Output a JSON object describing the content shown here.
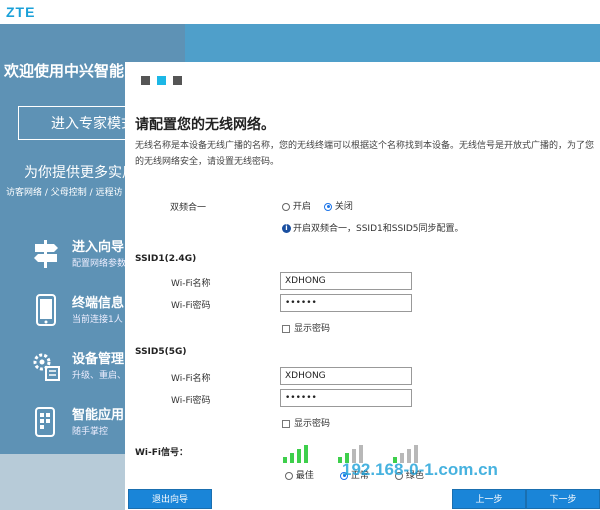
{
  "brand": {
    "logo": "ZTE"
  },
  "background": {
    "welcome": "欢迎使用中兴智能",
    "expert_button": "进入专家模式",
    "offer": "为你提供更多实用",
    "offer_sub": "访客网络 / 父母控制 / 远程访",
    "menu": [
      {
        "title": "进入向导",
        "sub": "配置网络参数",
        "icon": "signpost-icon"
      },
      {
        "title": "终端信息",
        "sub": "当前连接1人",
        "icon": "phone-icon"
      },
      {
        "title": "设备管理",
        "sub": "升级、重启、",
        "icon": "gears-icon"
      },
      {
        "title": "智能应用",
        "sub": "随手掌控",
        "icon": "apps-icon"
      }
    ]
  },
  "wizard": {
    "steps": [
      false,
      true,
      false
    ],
    "title": "请配置您的无线网络。",
    "description": "无线名称是本设备无线广播的名称，您的无线终端可以根据这个名称找到本设备。无线信号是开放式广播的，为了您的无线网络安全，请设置无线密码。",
    "dual_band": {
      "label": "双频合一",
      "options": [
        "开启",
        "关闭"
      ],
      "selected": "关闭",
      "hint": "开启双频合一，SSID1和SSID5同步配置。"
    },
    "ssid1": {
      "heading": "SSID1(2.4G)",
      "name_label": "Wi-Fi名称",
      "name_value": "XDHONG",
      "password_label": "Wi-Fi密码",
      "password_value": "••••••",
      "show_password": "显示密码"
    },
    "ssid5": {
      "heading": "SSID5(5G)",
      "name_label": "Wi-Fi名称",
      "name_value": "XDHONG",
      "password_label": "Wi-Fi密码",
      "password_value": "••••••",
      "show_password": "显示密码"
    },
    "signal": {
      "label": "Wi-Fi信号：",
      "options": [
        {
          "label": "最佳",
          "bars": 4,
          "selected": false
        },
        {
          "label": "正常",
          "bars": 2,
          "selected": true
        },
        {
          "label": "绿色",
          "bars": 1,
          "selected": false
        }
      ]
    },
    "buttons": {
      "exit": "退出向导",
      "prev": "上一步",
      "next": "下一步"
    }
  },
  "colors": {
    "accent": "#1cb7e6",
    "button": "#1a85d8",
    "signal_on": "#3ecf4c",
    "signal_off": "#b8b8b8"
  },
  "watermark": "192.168-0-1.com.cn"
}
